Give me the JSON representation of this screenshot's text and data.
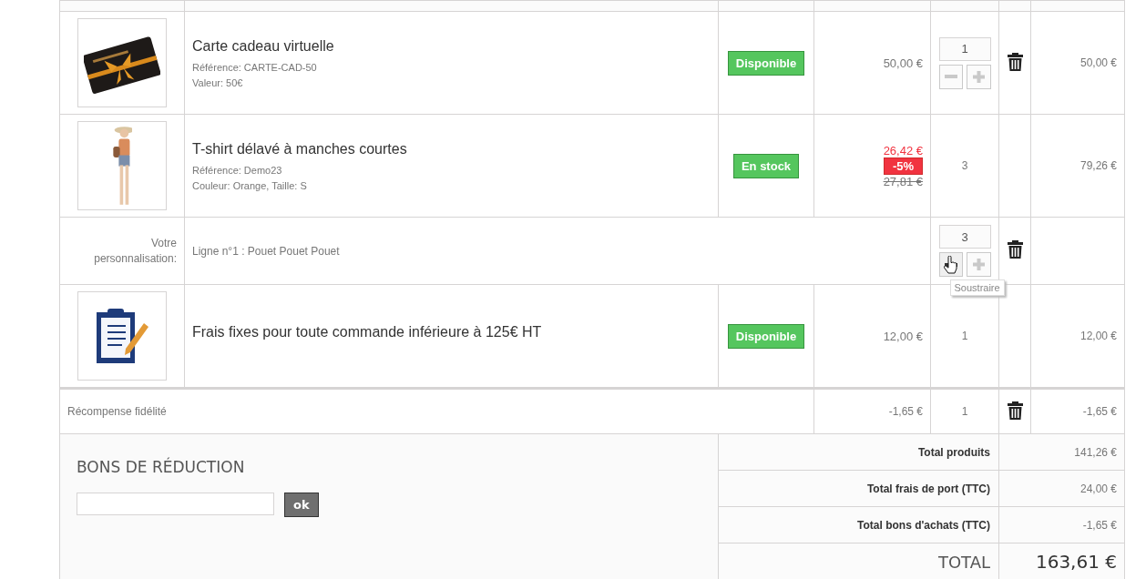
{
  "cart_rows": [
    {
      "kind": "product",
      "name": "Carte cadeau virtuelle",
      "details": [
        "Référence: CARTE-CAD-50",
        "Valeur: 50€"
      ],
      "availability": "Disponible",
      "price": {
        "current": "50,00 €"
      },
      "quantity": {
        "value": "1",
        "editable": true,
        "minus_hovered": false
      },
      "deletable": true,
      "total": "50,00 €"
    },
    {
      "kind": "product",
      "name": "T-shirt délavé à manches courtes",
      "details": [
        "Référence: Demo23",
        "Couleur: Orange, Taille: S"
      ],
      "availability": "En stock",
      "price": {
        "current": "26,42 €",
        "discount": "-5%",
        "old": "27,81 €"
      },
      "quantity": {
        "value": "3",
        "editable": false
      },
      "deletable": false,
      "total": "79,26 €"
    },
    {
      "kind": "customization",
      "label": "Votre personnalisation:",
      "text": "Ligne n°1 : Pouet Pouet Pouet",
      "quantity": {
        "value": "3",
        "editable": true,
        "minus_hovered": true
      },
      "deletable": true,
      "tooltip": "Soustraire"
    },
    {
      "kind": "product",
      "name": "Frais fixes pour toute commande inférieure à 125€ HT",
      "details": [],
      "availability": "Disponible",
      "price": {
        "current": "12,00 €"
      },
      "quantity": {
        "value": "1",
        "editable": false
      },
      "deletable": false,
      "total": "12,00 €"
    },
    {
      "kind": "reward",
      "name": "Récompense fidélité",
      "price": {
        "current": "-1,65 €"
      },
      "quantity": {
        "value": "1",
        "editable": false
      },
      "deletable": true,
      "total": "-1,65 €"
    }
  ],
  "vouchers": {
    "title": "BONS DE RÉDUCTION",
    "button": "ok"
  },
  "totals": [
    {
      "kind": "line",
      "label": "Total produits",
      "value": "141,26 €"
    },
    {
      "kind": "line",
      "label": "Total frais de port (TTC)",
      "value": "24,00 €"
    },
    {
      "kind": "line",
      "label": "Total bons d'achats (TTC)",
      "value": "-1,65 €"
    },
    {
      "kind": "grand",
      "label": "TOTAL",
      "value": "163,61 €"
    }
  ]
}
